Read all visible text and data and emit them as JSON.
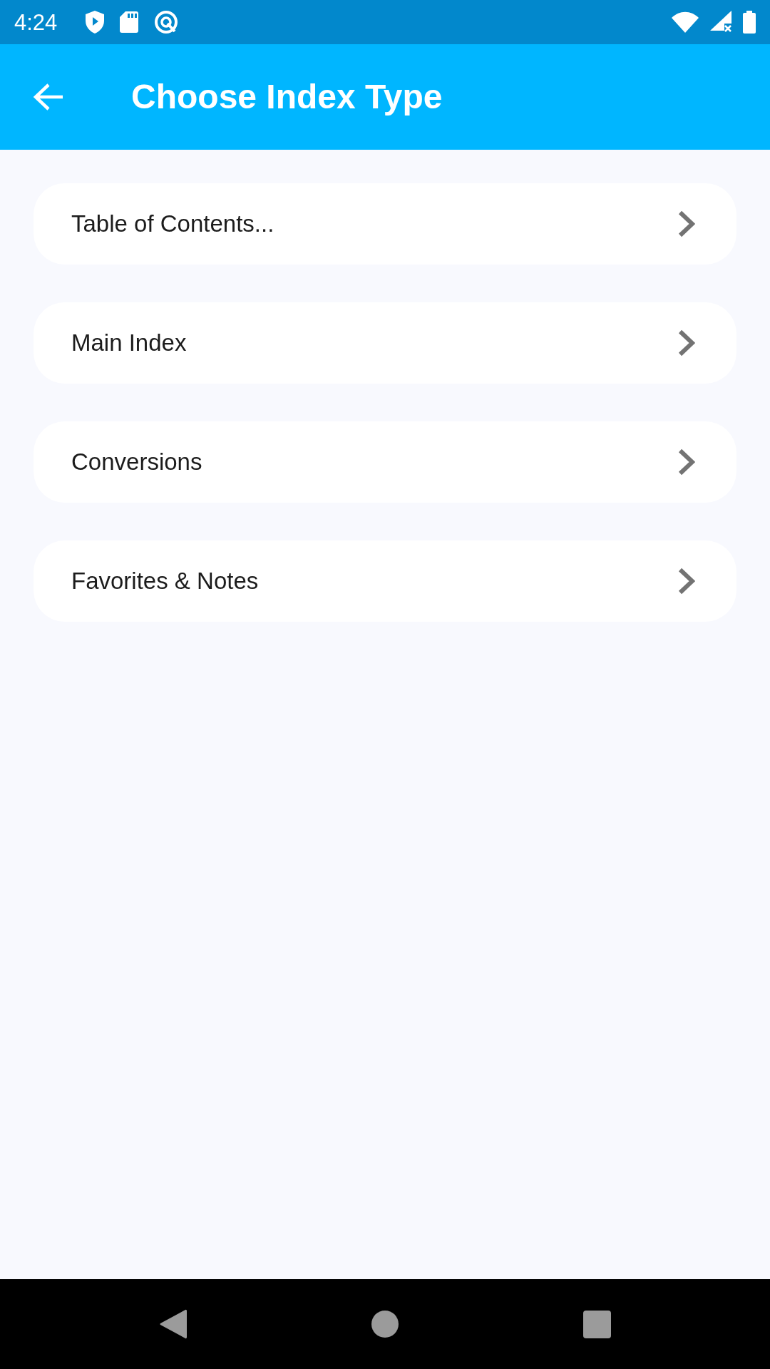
{
  "status_bar": {
    "time": "4:24"
  },
  "app_bar": {
    "title": "Choose Index Type"
  },
  "items": [
    {
      "label": "Table of Contents..."
    },
    {
      "label": "Main Index"
    },
    {
      "label": "Conversions"
    },
    {
      "label": "Favorites & Notes"
    }
  ]
}
